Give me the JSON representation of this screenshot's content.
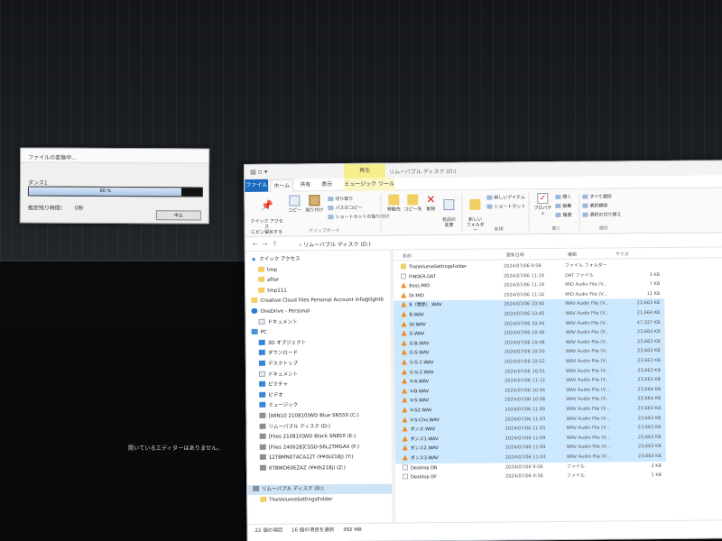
{
  "background": {
    "message": "開いているエディターはありません。"
  },
  "convert_dialog": {
    "title": "ファイルの変換中...",
    "file_label": "ダンス1",
    "progress_text": "80 %",
    "progress_value": 0.88,
    "remaining_label": "推定残り時間：",
    "remaining_value": "0秒",
    "cancel_label": "中止"
  },
  "explorer": {
    "title_tab": "再生",
    "window_title": "リムーバブル ディスク (D:)",
    "tabs": {
      "file": "ファイル",
      "home": "ホーム",
      "share": "共有",
      "view": "表示",
      "music": "ミュージック ツール"
    },
    "ribbon": {
      "quick_access": "クイック アクセス\nにピン留めする",
      "copy": "コピー",
      "paste": "貼り付け",
      "cut": "切り取り",
      "copy_path": "パスのコピー",
      "paste_shortcut": "ショートカットの貼り付け",
      "clipboard_group": "クリップボード",
      "move_to": "移動先",
      "copy_to": "コピー先",
      "delete": "削除",
      "rename": "名前の\n変更",
      "new_folder": "新しい\nフォルダー",
      "new_item": "新しいアイテム",
      "shortcut": "ショートカット",
      "new_group": "新規",
      "properties": "プロパティ",
      "open": "開く",
      "edit": "編集",
      "history": "履歴",
      "open_group": "開く",
      "select_all": "すべて選択",
      "select_none": "選択解除",
      "invert_select": "選択の切り替え",
      "select_group": "選択"
    },
    "address": "› リムーバブル ディスク (D:)",
    "columns": {
      "name": "名前",
      "date": "更新日時",
      "type": "種類",
      "size": "サイズ"
    },
    "nav_items": [
      {
        "label": "クイック アクセス",
        "icon": "star",
        "indent": 0,
        "selected": false
      },
      {
        "label": "tmp",
        "icon": "folder",
        "indent": 1,
        "selected": false
      },
      {
        "label": "after",
        "icon": "folder",
        "indent": 1,
        "selected": false
      },
      {
        "label": "tmp111",
        "icon": "folder",
        "indent": 1,
        "selected": false
      },
      {
        "label": "Creative Cloud Files Personal Account info@lightb",
        "icon": "folder",
        "indent": 0,
        "selected": false
      },
      {
        "label": "OneDrive - Personal",
        "icon": "cloud",
        "indent": 0,
        "selected": false
      },
      {
        "label": "ドキュメント",
        "icon": "doc",
        "indent": 1,
        "selected": false
      },
      {
        "label": "PC",
        "icon": "pc",
        "indent": 0,
        "selected": false
      },
      {
        "label": "3D オブジェクト",
        "icon": "blue",
        "indent": 1,
        "selected": false
      },
      {
        "label": "ダウンロード",
        "icon": "blue",
        "indent": 1,
        "selected": false
      },
      {
        "label": "デスクトップ",
        "icon": "blue",
        "indent": 1,
        "selected": false
      },
      {
        "label": "ドキュメント",
        "icon": "doc",
        "indent": 1,
        "selected": false
      },
      {
        "label": "ピクチャ",
        "icon": "blue",
        "indent": 1,
        "selected": false
      },
      {
        "label": "ビデオ",
        "icon": "blue",
        "indent": 1,
        "selected": false
      },
      {
        "label": "ミュージック",
        "icon": "blue",
        "indent": 1,
        "selected": false
      },
      {
        "label": "[WIN10 210810]WD Blue SN550 (C:)",
        "icon": "drive",
        "indent": 1,
        "selected": false
      },
      {
        "label": "リムーバブル ディスク (D:)",
        "icon": "drive",
        "indent": 1,
        "selected": false
      },
      {
        "label": "[Files 210810]WD Black SN850 (E:)",
        "icon": "drive",
        "indent": 1,
        "selected": false
      },
      {
        "label": "[Files 240628]CSSD-S6L2TMGAX (F:)",
        "icon": "drive",
        "indent": 1,
        "selected": false
      },
      {
        "label": "12TBMN07ACA12T (¥¥ds218j) (Y:)",
        "icon": "drive",
        "indent": 1,
        "selected": false
      },
      {
        "label": "6TBWD60EZAZ (¥¥ds218j) (Z:)",
        "icon": "drive",
        "indent": 1,
        "selected": false
      },
      {
        "label": "",
        "icon": "none",
        "indent": 0,
        "selected": false
      },
      {
        "label": "リムーバブル ディスク (D:)",
        "icon": "drive",
        "indent": 0,
        "selected": true
      },
      {
        "label": "TheVolumeSettingsFolder",
        "icon": "folder",
        "indent": 1,
        "selected": false
      }
    ],
    "files": [
      {
        "name": "TheVolumeSettingsFolder",
        "date": "2024/07/06 9:58",
        "type": "ファイル フォルダー",
        "size": "",
        "icon": "folder",
        "selected": false
      },
      {
        "name": "FINDER.DAT",
        "date": "2024/07/06 11:19",
        "type": "DAT ファイル",
        "size": "3 KB",
        "icon": "blank",
        "selected": false
      },
      {
        "name": "Bass.MID",
        "date": "2024/07/06 11:19",
        "type": "MID Audio File (V...",
        "size": "7 KB",
        "icon": "vlc",
        "selected": false
      },
      {
        "name": "Dr.MID",
        "date": "2024/07/06 11:16",
        "type": "MID Audio File (V...",
        "size": "12 KB",
        "icon": "vlc",
        "selected": false
      },
      {
        "name": "B（情熱）.WAV",
        "date": "2024/07/06 10:40",
        "type": "WAV Audio File (V...",
        "size": "23,663 KB",
        "icon": "vlc",
        "selected": true
      },
      {
        "name": "B.WAV",
        "date": "2024/07/06 10:40",
        "type": "WAV Audio File (V...",
        "size": "21,664 KB",
        "icon": "vlc",
        "selected": true
      },
      {
        "name": "Dr.WAV",
        "date": "2024/07/06 10:40",
        "type": "WAV Audio File (V...",
        "size": "47,327 KB",
        "icon": "vlc",
        "selected": true
      },
      {
        "name": "G.WAV",
        "date": "2024/07/06 10:46",
        "type": "WAV Audio File (V...",
        "size": "23,664 KB",
        "icon": "vlc",
        "selected": true
      },
      {
        "name": "G-B.WAV",
        "date": "2024/07/06 10:48",
        "type": "WAV Audio File (V...",
        "size": "23,663 KB",
        "icon": "vlc",
        "selected": true
      },
      {
        "name": "G-S.WAV",
        "date": "2024/07/06 10:50",
        "type": "WAV Audio File (V...",
        "size": "23,663 KB",
        "icon": "vlc",
        "selected": true
      },
      {
        "name": "G-S-1.WAV",
        "date": "2024/07/06 10:52",
        "type": "WAV Audio File (V...",
        "size": "23,663 KB",
        "icon": "vlc",
        "selected": true
      },
      {
        "name": "G-S-2.WAV",
        "date": "2024/07/06 10:55",
        "type": "WAV Audio File (V...",
        "size": "23,663 KB",
        "icon": "vlc",
        "selected": true
      },
      {
        "name": "V-A.WAV",
        "date": "2024/07/06 11:12",
        "type": "WAV Audio File (V...",
        "size": "23,663 KB",
        "icon": "vlc",
        "selected": true
      },
      {
        "name": "V-B.WAV",
        "date": "2024/07/06 10:56",
        "type": "WAV Audio File (V...",
        "size": "23,664 KB",
        "icon": "vlc",
        "selected": true
      },
      {
        "name": "V-S.WAV",
        "date": "2024/07/06 10:58",
        "type": "WAV Audio File (V...",
        "size": "23,664 KB",
        "icon": "vlc",
        "selected": true
      },
      {
        "name": "V-S2.WAV",
        "date": "2024/07/06 11:00",
        "type": "WAV Audio File (V...",
        "size": "23,663 KB",
        "icon": "vlc",
        "selected": true
      },
      {
        "name": "V-S-Cho.WAV",
        "date": "2024/07/06 11:03",
        "type": "WAV Audio File (V...",
        "size": "23,663 KB",
        "icon": "vlc",
        "selected": true
      },
      {
        "name": "ダンス.WAV",
        "date": "2024/07/06 11:05",
        "type": "WAV Audio File (V...",
        "size": "23,663 KB",
        "icon": "vlc",
        "selected": true
      },
      {
        "name": "ダンス1.WAV",
        "date": "2024/07/06 11:09",
        "type": "WAV Audio File (V...",
        "size": "23,663 KB",
        "icon": "vlc",
        "selected": true
      },
      {
        "name": "ダンス2.WAV",
        "date": "2024/07/06 11:09",
        "type": "WAV Audio File (V...",
        "size": "23,663 KB",
        "icon": "vlc",
        "selected": true
      },
      {
        "name": "ダンス3.WAV",
        "date": "2024/07/06 11:03",
        "type": "WAV Audio File (V...",
        "size": "23,663 KB",
        "icon": "vlc",
        "selected": true
      },
      {
        "name": "Desktop DB",
        "date": "2024/07/06 9:58",
        "type": "ファイル",
        "size": "2 KB",
        "icon": "blank",
        "selected": false
      },
      {
        "name": "Desktop DF",
        "date": "2024/07/06 9:58",
        "type": "ファイル",
        "size": "1 KB",
        "icon": "blank",
        "selected": false
      }
    ],
    "status": {
      "count": "22 個の項目",
      "selected": "16 個の項目を選択",
      "size": "392 MB"
    }
  }
}
